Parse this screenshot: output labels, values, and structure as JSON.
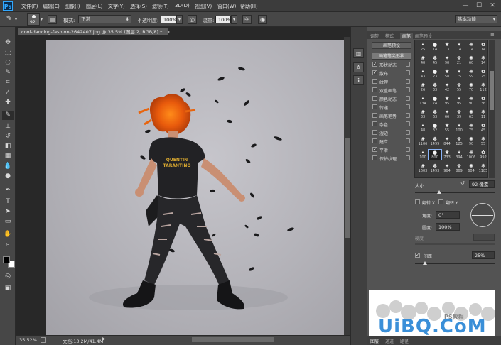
{
  "app": {
    "logo": "Ps",
    "window_controls": [
      "—",
      "☐",
      "✕"
    ]
  },
  "menu": [
    "文件(F)",
    "编辑(E)",
    "图像(I)",
    "图层(L)",
    "文字(Y)",
    "选择(S)",
    "滤镜(T)",
    "3D(D)",
    "视图(V)",
    "窗口(W)",
    "帮助(H)"
  ],
  "options": {
    "brush_size": "92",
    "mode_label": "模式:",
    "mode_value": "正常",
    "opacity_label": "不透明度:",
    "opacity_value": "100%",
    "flow_label": "流量:",
    "flow_value": "100%",
    "workspace": "基本功能"
  },
  "document": {
    "tab_title": "cool-dancing-fashion-2642407.jpg @ 35.5% (图层 2, RGB/8) *",
    "tab_close": "×",
    "zoom": "35.52%",
    "doc_size": "文档:13.2M/41.4M",
    "shirt_line1": "QUENTIN",
    "shirt_line2": "TARANTINO"
  },
  "panel": {
    "tabs": [
      "调整",
      "样式",
      "画笔",
      "画笔预设"
    ],
    "active_tab": "画笔",
    "preset_button": "画笔预设",
    "tip_shape_button": "画笔笔尖形状",
    "options": [
      {
        "label": "形状动态",
        "checked": true
      },
      {
        "label": "散布",
        "checked": true
      },
      {
        "label": "纹理",
        "checked": false
      },
      {
        "label": "双重画笔",
        "checked": false
      },
      {
        "label": "颜色动态",
        "checked": false
      },
      {
        "label": "传递",
        "checked": false
      },
      {
        "label": "画笔笔势",
        "checked": false
      },
      {
        "label": "杂色",
        "checked": false
      },
      {
        "label": "湿边",
        "checked": false
      },
      {
        "label": "建立",
        "checked": false
      },
      {
        "label": "平滑",
        "checked": true
      },
      {
        "label": "保护纹理",
        "checked": false
      }
    ],
    "brush_numbers": [
      [
        "25",
        "14",
        "13",
        "14",
        "14",
        "14"
      ],
      [
        "40",
        "45",
        "90",
        "21",
        "60",
        "14"
      ],
      [
        "43",
        "23",
        "58",
        "75",
        "59",
        "25"
      ],
      [
        "26",
        "33",
        "42",
        "55",
        "70",
        "112"
      ],
      [
        "134",
        "74",
        "95",
        "95",
        "90",
        "36"
      ],
      [
        "33",
        "63",
        "66",
        "39",
        "63",
        "11"
      ],
      [
        "48",
        "32",
        "55",
        "100",
        "75",
        "45"
      ],
      [
        "1106",
        "1499",
        "844",
        "125",
        "90",
        "55"
      ],
      [
        "100",
        "800",
        "733",
        "394",
        "1006",
        "992"
      ],
      [
        "1603",
        "1493",
        "964",
        "869",
        "604",
        "1185"
      ]
    ],
    "size_label": "大小",
    "size_value": "92 像素",
    "flip_x_label": "翻转 X",
    "flip_y_label": "翻转 Y",
    "angle_label": "角度:",
    "angle_value": "0°",
    "roundness_label": "圆度:",
    "roundness_value": "100%",
    "hardness_label": "硬度",
    "spacing_label": "间距",
    "spacing_value": "25%",
    "spacing_checked": true
  },
  "bottom_tabs": [
    "图层",
    "通道",
    "路径"
  ],
  "watermark": {
    "main": "UiBQ.CoM",
    "badge": "PS教程"
  }
}
